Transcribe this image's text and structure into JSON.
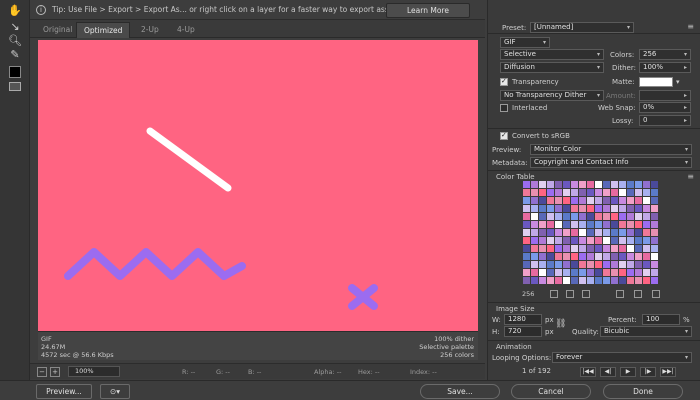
{
  "tip": {
    "text": "Tip: Use File > Export > Export As...  or right click on a layer for a faster way to export assets",
    "learn_more": "Learn More"
  },
  "tabs": [
    {
      "label": "Original"
    },
    {
      "label": "Optimized"
    },
    {
      "label": "2-Up"
    },
    {
      "label": "4-Up"
    }
  ],
  "canvas_info": {
    "left": [
      "GIF",
      "24.67M",
      "4572 sec @ 56.6 Kbps"
    ],
    "right": [
      "100% dither",
      "Selective palette",
      "256 colors"
    ],
    "background": "#ff6482"
  },
  "status": {
    "zoom": "100%",
    "r": "R: --",
    "g": "G: --",
    "b": "B: --",
    "alpha": "Alpha: --",
    "hex": "Hex: --",
    "index": "Index: --"
  },
  "bottom": {
    "preview": "Preview...",
    "save": "Save...",
    "cancel": "Cancel",
    "done": "Done"
  },
  "panel": {
    "preset_label": "Preset:",
    "preset_value": "[Unnamed]",
    "format": "GIF",
    "reduction": "Selective",
    "colors_label": "Colors:",
    "colors_value": "256",
    "dither_algo": "Diffusion",
    "dither_label": "Dither:",
    "dither_value": "100%",
    "transparency": "Transparency",
    "matte_label": "Matte:",
    "transp_dither": "No Transparency Dither",
    "amount_label": "Amount:",
    "interlaced": "Interlaced",
    "websnap_label": "Web Snap:",
    "websnap_value": "0%",
    "lossy_label": "Lossy:",
    "lossy_value": "0",
    "convert_srgb": "Convert to sRGB",
    "preview_label": "Preview:",
    "preview_value": "Monitor Color",
    "metadata_label": "Metadata:",
    "metadata_value": "Copyright and Contact Info",
    "color_table_title": "Color Table",
    "color_count": "256",
    "image_size_title": "Image Size",
    "w_label": "W:",
    "w_value": "1280",
    "h_label": "H:",
    "h_value": "720",
    "px": "px",
    "percent_label": "Percent:",
    "percent_value": "100",
    "pct": "%",
    "quality_label": "Quality:",
    "quality_value": "Bicubic",
    "animation_title": "Animation",
    "looping_label": "Looping Options:",
    "looping_value": "Forever",
    "frame_counter": "1 of 192"
  },
  "colors": {
    "accent_pink": "#ff6482",
    "shape_purple": "#9b6cf0",
    "shape_white": "#ffffff"
  }
}
